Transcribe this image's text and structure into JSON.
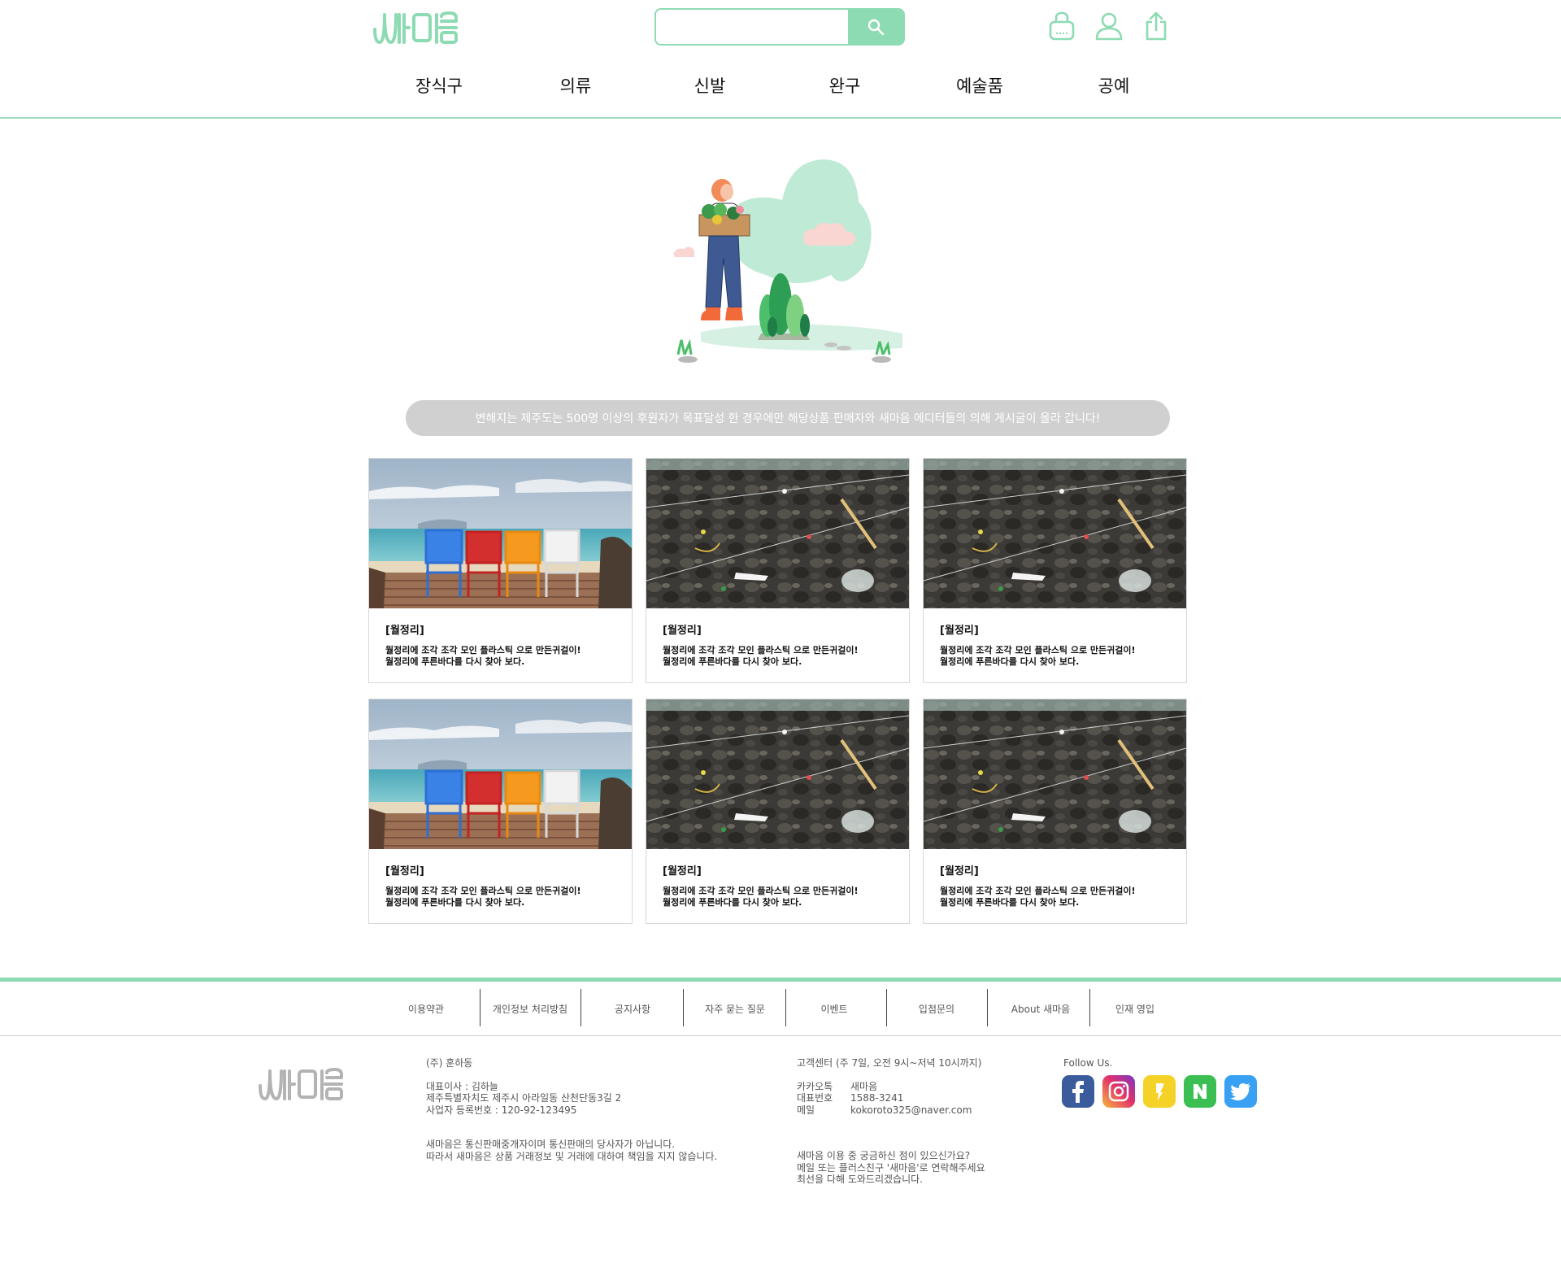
{
  "header": {
    "logo_alt": "새마음",
    "search": {
      "placeholder": "",
      "value": ""
    },
    "icons": [
      "cart-icon",
      "user-icon",
      "share-icon"
    ]
  },
  "nav": {
    "items": [
      {
        "label": "장식구"
      },
      {
        "label": "의류"
      },
      {
        "label": "신발"
      },
      {
        "label": "완구"
      },
      {
        "label": "예술품"
      },
      {
        "label": "공예"
      }
    ]
  },
  "notice": "변해지는 제주도는 500명 이상의 후원자가 목표달성 한 경우에만 해당상품 판매자와 새마음 에디터들의 의해 게시글이 올라 갑니다!",
  "cards": [
    {
      "image": "beach-chairs",
      "title": "[월정리]",
      "desc_line1": "월정리에 조각 조각 모인 플라스틱 으로 만든귀걸이!",
      "desc_line2": "월정리에 푸른바다를 다시 찾아 보다."
    },
    {
      "image": "rocky-shore",
      "title": "[월정리]",
      "desc_line1": "월정리에 조각 조각 모인 플라스틱 으로 만든귀걸이!",
      "desc_line2": "월정리에 푸른바다를 다시 찾아 보다."
    },
    {
      "image": "rocky-shore",
      "title": "[월정리]",
      "desc_line1": "월정리에 조각 조각 모인 플라스틱 으로 만든귀걸이!",
      "desc_line2": "월정리에 푸른바다를 다시 찾아 보다."
    },
    {
      "image": "beach-chairs",
      "title": "[월정리]",
      "desc_line1": "월정리에 조각 조각 모인 플라스틱 으로 만든귀걸이!",
      "desc_line2": "월정리에 푸른바다를 다시 찾아 보다."
    },
    {
      "image": "rocky-shore",
      "title": "[월정리]",
      "desc_line1": "월정리에 조각 조각 모인 플라스틱 으로 만든귀걸이!",
      "desc_line2": "월정리에 푸른바다를 다시 찾아 보다."
    },
    {
      "image": "rocky-shore",
      "title": "[월정리]",
      "desc_line1": "월정리에 조각 조각 모인 플라스틱 으로 만든귀걸이!",
      "desc_line2": "월정리에 푸른바다를 다시 찾아 보다."
    }
  ],
  "footer": {
    "nav": [
      {
        "label": "이용약관"
      },
      {
        "label": "개인정보 처리방침"
      },
      {
        "label": "공지사항"
      },
      {
        "label": "자주 묻는 질문"
      },
      {
        "label": "이벤트"
      },
      {
        "label": "입점문의"
      },
      {
        "label": "About 새마음"
      },
      {
        "label": "인재 영입"
      }
    ],
    "company": {
      "name": "(주) 훈하동",
      "ceo": "대표이사 : 김하늘",
      "address": "제주특별자치도 제주시 아라일동 산천단동3길 2",
      "business_no": "사업자 등록번호 : 120-92-123495",
      "disclaimer1": "새마음은 통신판매중개자이며 통신판매의 당사자가 아닙니다.",
      "disclaimer2": "따라서 새마음은 상품 거래정보 및 거래에 대하여 책임을 지지 않습니다."
    },
    "support": {
      "title": "고객센터 (주 7일, 오전 9시~저녁 10시까지)",
      "kakao_label": "카카오톡",
      "kakao_value": "새마음",
      "phone_label": "대표번호",
      "phone_value": "1588-3241",
      "email_label": "메일",
      "email_value": "kokoroto325@naver.com",
      "note1": "새마음 이용 중 궁금하신 점이 있으신가요?",
      "note2": "메일 또는 플러스친구 '새마음'로 연락해주세요",
      "note3": "최선을 다해 도와드리겠습니다."
    },
    "follow_label": "Follow Us.",
    "social": [
      "facebook-icon",
      "instagram-icon",
      "kakaostory-icon",
      "naver-icon",
      "twitter-icon"
    ]
  },
  "colors": {
    "accent": "#8ddbb2",
    "notice_bg": "#d0d0d0"
  }
}
